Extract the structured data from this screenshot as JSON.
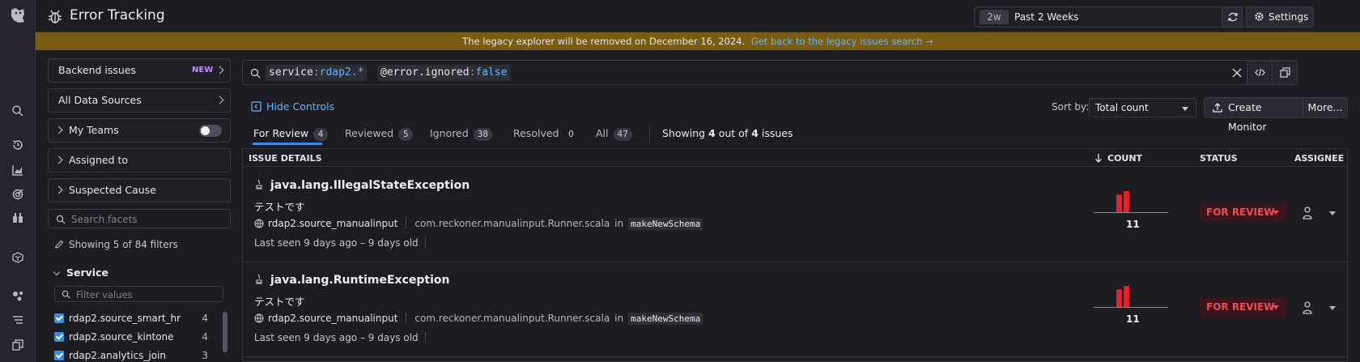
{
  "header": {
    "title": "Error Tracking"
  },
  "time_range": {
    "chip": "2w",
    "label": "Past 2 Weeks"
  },
  "settings_label": "Settings",
  "banner": {
    "text": "The legacy explorer will be removed on December 16, 2024.",
    "link": "Get back to the legacy issues search →"
  },
  "left_panel": {
    "backend_issues": "Backend issues",
    "new_badge": "NEW",
    "data_sources": "All Data Sources",
    "my_teams": "My Teams",
    "assigned_to": "Assigned to",
    "suspected_cause": "Suspected Cause",
    "search_facets_placeholder": "Search facets",
    "showing_filters": "Showing 5 of 84 filters",
    "service_heading": "Service",
    "filter_values_placeholder": "Filter values",
    "services": [
      {
        "name": "rdap2.source_smart_hr",
        "count": "4"
      },
      {
        "name": "rdap2.source_kintone",
        "count": "4"
      },
      {
        "name": "rdap2.analytics_join",
        "count": "3"
      }
    ]
  },
  "query": {
    "tokens": [
      {
        "key": "service",
        "sep": ":",
        "value": "rdap2.*"
      },
      {
        "key": "@error.ignored",
        "sep": ":",
        "value": "false"
      }
    ]
  },
  "controls": {
    "hide_controls": "Hide Controls",
    "sort_by": "Sort by:",
    "sort_value": "Total count",
    "create_monitor": "Create Monitor",
    "more": "More..."
  },
  "tabs": [
    {
      "label": "For Review",
      "count": "4"
    },
    {
      "label": "Reviewed",
      "count": "5"
    },
    {
      "label": "Ignored",
      "count": "38"
    },
    {
      "label": "Resolved",
      "count": "0"
    },
    {
      "label": "All",
      "count": "47"
    }
  ],
  "showing": {
    "pre": "Showing ",
    "shown": "4",
    "mid": " out of ",
    "total": "4",
    "post": " issues"
  },
  "table": {
    "headers": {
      "details": "ISSUE DETAILS",
      "count": "COUNT",
      "status": "STATUS",
      "assignee": "ASSIGNEE"
    },
    "rows": [
      {
        "exception": "java.lang.IllegalStateException",
        "message": "テストです",
        "service": "rdap2.source_manualinput",
        "file": "com.reckoner.manualinput.Runner.scala",
        "in": "in",
        "function": "makeNewSchema",
        "seen": "Last seen 9 days ago – 9 days old",
        "count": "11",
        "spark": [
          5,
          6
        ],
        "status": "FOR REVIEW"
      },
      {
        "exception": "java.lang.RuntimeException",
        "message": "テストです",
        "service": "rdap2.source_manualinput",
        "file": "com.reckoner.manualinput.Runner.scala",
        "in": "in",
        "function": "makeNewSchema",
        "seen": "Last seen 9 days ago – 9 days old",
        "count": "11",
        "spark": [
          5,
          6
        ],
        "status": "FOR REVIEW"
      }
    ]
  },
  "colors": {
    "accent": "#3a8dde",
    "link": "#63b5ff",
    "banner": "#7a5d12",
    "status_red": "#f04b55",
    "spark_red": "#e0222c"
  }
}
